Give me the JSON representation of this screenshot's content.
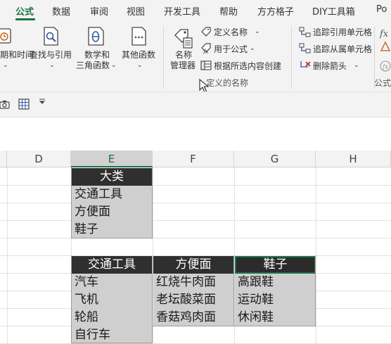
{
  "tabs": [
    {
      "label": "公式",
      "active": true
    },
    {
      "label": "数据"
    },
    {
      "label": "审阅"
    },
    {
      "label": "视图"
    },
    {
      "label": "开发工具"
    },
    {
      "label": "帮助"
    },
    {
      "label": "方方格子"
    },
    {
      "label": "DIY工具箱"
    },
    {
      "label": "Po"
    }
  ],
  "ribbon": {
    "function_library": {
      "datetime_label_1": "期和时间",
      "lookup_label": "查找与引用",
      "math_label_1": "数学和",
      "math_label_2": "三角函数",
      "more_label": "其他函数"
    },
    "defined_names": {
      "name_manager_1": "名称",
      "name_manager_2": "管理器",
      "define_name": "定义名称",
      "use_in_formula": "用于公式",
      "create_from_selection": "根据所选内容创建",
      "group_label": "定义的名称"
    },
    "formula_auditing": {
      "trace_precedents": "追踪引用单元格",
      "trace_dependents": "追踪从属单元格",
      "remove_arrows": "删除箭头",
      "group_label": "公式"
    }
  },
  "columns": [
    "D",
    "E",
    "F",
    "G",
    "H"
  ],
  "sheet": {
    "category_header": "大类",
    "categories": [
      "交通工具",
      "方便面",
      "鞋子"
    ],
    "lists": [
      {
        "header": "交通工具",
        "items": [
          "汽车",
          "飞机",
          "轮船",
          "自行车"
        ]
      },
      {
        "header": "方便面",
        "items": [
          "红烧牛肉面",
          "老坛酸菜面",
          "香菇鸡肉面"
        ]
      },
      {
        "header": "鞋子",
        "items": [
          "高跟鞋",
          "运动鞋",
          "休闲鞋"
        ]
      }
    ]
  },
  "colors": {
    "accent": "#1e7145",
    "header_bg": "#2f2f2f",
    "cell_grey": "#cfcfcf"
  },
  "icons": [
    "calendar-icon",
    "lookup-icon",
    "math-trig-icon",
    "more-functions-icon",
    "name-manager-icon",
    "define-name-icon",
    "use-in-formula-icon",
    "create-from-selection-icon",
    "trace-precedents-icon",
    "trace-dependents-icon",
    "remove-arrows-icon",
    "camera-icon",
    "table-icon",
    "dropdown-icon",
    "cursor-icon"
  ]
}
